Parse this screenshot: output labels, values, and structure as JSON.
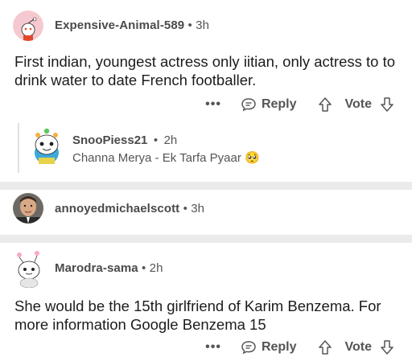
{
  "comments": [
    {
      "author": "Expensive-Animal-589",
      "time": "3h",
      "body": "First indian, youngest actress only iitian, only actress to to drink water to date French footballer.",
      "actions": {
        "more": "•••",
        "reply": "Reply",
        "vote": "Vote"
      },
      "replies": [
        {
          "author": "SnooPiess21",
          "time": "2h",
          "body": "Channa Merya - Ek Tarfa Pyaar 🥺"
        }
      ]
    },
    {
      "author": "annoyedmichaelscott",
      "time": "3h"
    },
    {
      "author": "Marodra-sama",
      "time": "2h",
      "body": "She would be the 15th girlfriend of Karim Benzema. For more information Google Benzema 15",
      "actions": {
        "more": "•••",
        "reply": "Reply",
        "vote": "Vote"
      }
    }
  ],
  "separator": "•",
  "colors": {
    "background": "#ffffff",
    "divider": "#ebebeb",
    "text": "#1c1c1c",
    "muted": "#555555"
  }
}
